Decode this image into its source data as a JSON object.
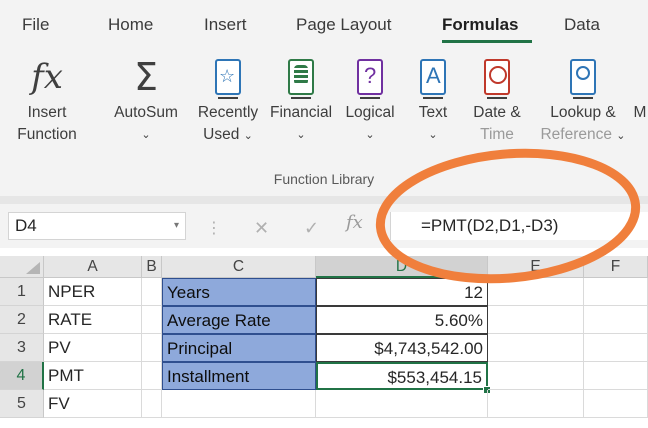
{
  "ribbon": {
    "tabs": [
      "File",
      "Home",
      "Insert",
      "Page Layout",
      "Formulas",
      "Data"
    ],
    "active_tab": "Formulas",
    "commands": {
      "insert_function": {
        "line1": "Insert",
        "line2": "Function"
      },
      "autosum": {
        "line1": "AutoSum"
      },
      "recently_used": {
        "line1": "Recently",
        "line2": "Used"
      },
      "financial": {
        "line1": "Financial"
      },
      "logical": {
        "line1": "Logical"
      },
      "text": {
        "line1": "Text"
      },
      "date_time": {
        "line1": "Date &",
        "line2": "Time"
      },
      "lookup": {
        "line1": "Lookup &",
        "line2": "Reference"
      },
      "more": {
        "line1": "M"
      }
    },
    "group_label": "Function Library",
    "accent": "#217346"
  },
  "formula_bar": {
    "name_box": "D4",
    "cancel_glyph": "✕",
    "enter_glyph": "✓",
    "fx_glyph": "fx",
    "formula": "=PMT(D2,D1,-D3)"
  },
  "grid": {
    "columns": [
      "A",
      "B",
      "C",
      "D",
      "E",
      "F"
    ],
    "selected_column": "D",
    "rows": [
      {
        "num": "1",
        "a": "NPER",
        "c": "Years",
        "d": "12"
      },
      {
        "num": "2",
        "a": "RATE",
        "c": "Average Rate",
        "d": "5.60%"
      },
      {
        "num": "3",
        "a": "PV",
        "c": "Principal",
        "d": "$4,743,542.00"
      },
      {
        "num": "4",
        "a": "PMT",
        "c": "Installment",
        "d": "$553,454.15"
      },
      {
        "num": "5",
        "a": "FV",
        "c": "",
        "d": ""
      }
    ],
    "selected_row": "4",
    "label_fill": "#8ea9db"
  },
  "annotation": {
    "shape": "ellipse",
    "color": "#f07f3c"
  }
}
